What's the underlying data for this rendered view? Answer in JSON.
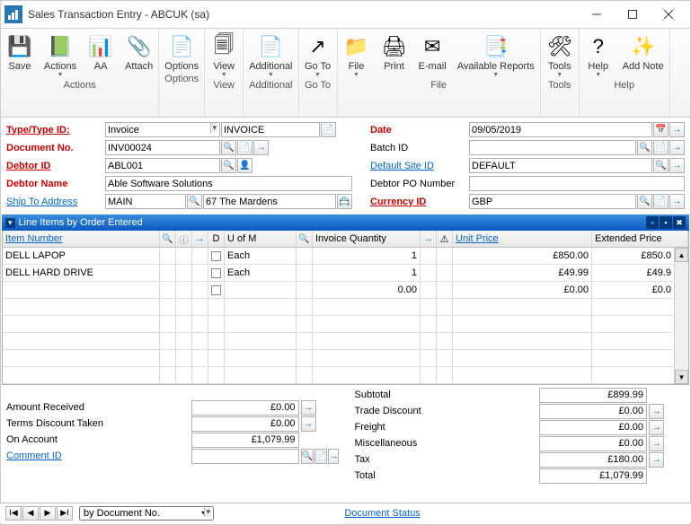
{
  "window": {
    "title": "Sales Transaction Entry  -  ABCUK (sa)"
  },
  "ribbon": {
    "groups": [
      {
        "label": "Actions",
        "buttons": [
          {
            "name": "save-button",
            "label": "Save",
            "icon": "💾",
            "dd": false
          },
          {
            "name": "actions-button",
            "label": "Actions",
            "icon": "📗",
            "dd": true
          },
          {
            "name": "aa-button",
            "label": "AA",
            "icon": "📊",
            "dd": false
          },
          {
            "name": "attach-button",
            "label": "Attach",
            "icon": "📎",
            "dd": false
          }
        ]
      },
      {
        "label": "Options",
        "buttons": [
          {
            "name": "options-button",
            "label": "Options",
            "icon": "📄",
            "dd": false
          }
        ]
      },
      {
        "label": "View",
        "buttons": [
          {
            "name": "view-button",
            "label": "View",
            "icon": "🗐",
            "dd": true
          }
        ]
      },
      {
        "label": "Additional",
        "buttons": [
          {
            "name": "additional-button",
            "label": "Additional",
            "icon": "📄",
            "dd": true
          }
        ]
      },
      {
        "label": "Go To",
        "buttons": [
          {
            "name": "goto-button",
            "label": "Go To",
            "icon": "↗",
            "dd": true
          }
        ]
      },
      {
        "label": "File",
        "buttons": [
          {
            "name": "file-button",
            "label": "File",
            "icon": "📁",
            "dd": true
          },
          {
            "name": "print-button",
            "label": "Print",
            "icon": "🖨",
            "dd": false
          },
          {
            "name": "email-button",
            "label": "E-mail",
            "icon": "✉",
            "dd": false
          },
          {
            "name": "reports-button",
            "label": "Available Reports",
            "icon": "📑",
            "dd": true
          }
        ]
      },
      {
        "label": "Tools",
        "buttons": [
          {
            "name": "tools-button",
            "label": "Tools",
            "icon": "🛠",
            "dd": true
          }
        ]
      },
      {
        "label": "Help",
        "buttons": [
          {
            "name": "help-button",
            "label": "Help",
            "icon": "?",
            "dd": true
          },
          {
            "name": "add-note-button",
            "label": "Add Note",
            "icon": "✨",
            "dd": false
          }
        ]
      }
    ]
  },
  "form": {
    "type_label": "Type/Type ID:",
    "type_value": "Invoice",
    "type_code": "INVOICE",
    "docno_label": "Document No.",
    "docno_value": "INV00024",
    "debtorid_label": "Debtor ID",
    "debtorid_value": "ABL001",
    "debtorname_label": "Debtor Name",
    "debtorname_value": "Able Software Solutions",
    "shipto_label": "Ship To Address",
    "shipto_value": "MAIN",
    "shipto_addr": "67 The Mardens",
    "date_label": "Date",
    "date_value": "09/05/2019",
    "batch_label": "Batch ID",
    "batch_value": "",
    "site_label": "Default Site ID",
    "site_value": "DEFAULT",
    "po_label": "Debtor PO Number",
    "po_value": "",
    "curr_label": "Currency ID",
    "curr_value": "GBP"
  },
  "grid": {
    "title": "Line Items by Order Entered",
    "headers": {
      "item": "Item Number",
      "d": "D",
      "uom": "U of M",
      "qty": "Invoice Quantity",
      "price": "Unit Price",
      "ext": "Extended Price"
    },
    "rows": [
      {
        "item": "DELL LAPOP",
        "uom": "Each",
        "qty": "1",
        "price": "£850.00",
        "ext": "£850.0"
      },
      {
        "item": "DELL HARD DRIVE",
        "uom": "Each",
        "qty": "1",
        "price": "£49.99",
        "ext": "£49.9"
      },
      {
        "item": "",
        "uom": "",
        "qty": "0.00",
        "price": "£0.00",
        "ext": "£0.0"
      }
    ]
  },
  "amounts": {
    "received_label": "Amount Received",
    "received": "£0.00",
    "terms_label": "Terms Discount Taken",
    "terms": "£0.00",
    "onacct_label": "On Account",
    "onacct": "£1,079.99",
    "comment_label": "Comment ID",
    "comment": ""
  },
  "totals": {
    "subtotal_label": "Subtotal",
    "subtotal": "£899.99",
    "trade_label": "Trade Discount",
    "trade": "£0.00",
    "freight_label": "Freight",
    "freight": "£0.00",
    "misc_label": "Miscellaneous",
    "misc": "£0.00",
    "tax_label": "Tax",
    "tax": "£180.00",
    "total_label": "Total",
    "total": "£1,079.99"
  },
  "nav": {
    "sort": "by Document No.",
    "status_link": "Document Status"
  }
}
